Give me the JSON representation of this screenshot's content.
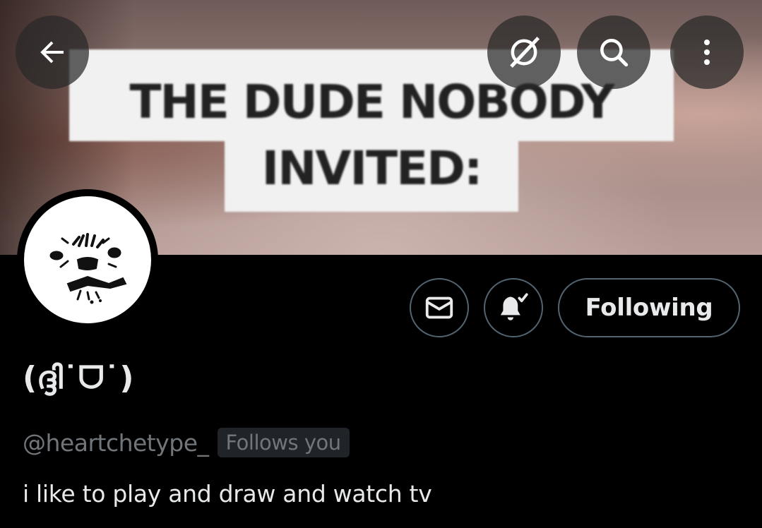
{
  "banner": {
    "caption_line1": "THE DUDE NOBODY",
    "caption_line2": "INVITED:"
  },
  "header": {
    "back_icon": "arrow-left-icon",
    "grok_icon": "grok-icon",
    "search_icon": "search-icon",
    "more_icon": "more-vertical-icon"
  },
  "profile": {
    "display_name": "(ദ്ദി˙ᗜ˙)",
    "handle": "@heartchetype_",
    "follows_you": "Follows you",
    "bio": "i like to play and draw and watch tv"
  },
  "actions": {
    "message_icon": "envelope-icon",
    "notify_icon": "bell-check-icon",
    "following_label": "Following"
  },
  "colors": {
    "background": "#000000",
    "text_primary": "#e7e9ea",
    "text_secondary": "#71767b",
    "button_border": "#536471",
    "badge_bg": "#202327"
  }
}
